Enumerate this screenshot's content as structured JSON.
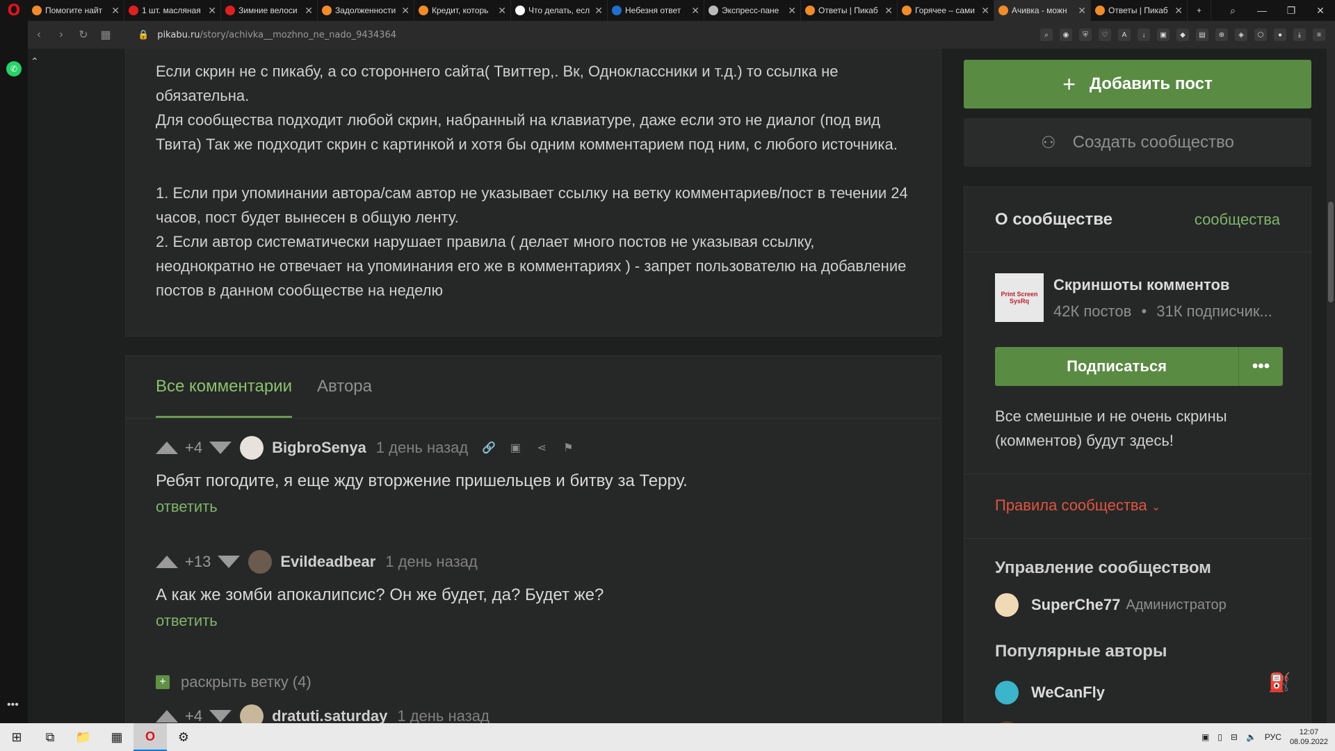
{
  "browser": {
    "tabs": [
      {
        "title": "Помогите найт",
        "fav_color": "#f28c2a"
      },
      {
        "title": "1 шт. масляная",
        "fav_color": "#e02020"
      },
      {
        "title": "Зимние велоси",
        "fav_color": "#e02020"
      },
      {
        "title": "Задолженности",
        "fav_color": "#f28c2a"
      },
      {
        "title": "Кредит, которь",
        "fav_color": "#f28c2a"
      },
      {
        "title": "Что делать, есл",
        "fav_color": "#ffffff"
      },
      {
        "title": "Небезня ответ",
        "fav_color": "#1f6fd1"
      },
      {
        "title": "Экспресс-пане",
        "fav_color": "#bbbbbb"
      },
      {
        "title": "Ответы | Пикаб",
        "fav_color": "#f28c2a"
      },
      {
        "title": "Горячее – сами",
        "fav_color": "#f28c2a"
      },
      {
        "title": "Ачивка - можн",
        "fav_color": "#f28c2a",
        "active": true
      },
      {
        "title": "Ответы | Пикаб",
        "fav_color": "#f28c2a"
      }
    ],
    "url_host": "pikabu.ru",
    "url_path": "/story/achivka__mozhno_ne_nado_9434364"
  },
  "post": {
    "para1": "Если скрин не с пикабу, а со стороннего сайта( Твиттер,. Вк, Одноклассники и т.д.) то ссылка не обязательна.",
    "para2": "Для сообщества подходит любой скрин, набранный на клавиатуре, даже если это не диалог (под вид Твита) Так же подходит скрин с картинкой и хотя бы одним комментарием под ним, с любого источника.",
    "rule1": "1. Если при упоминании автора/сам автор не указывает ссылку на ветку комментариев/пост в течении 24 часов, пост будет вынесен в общую ленту.",
    "rule2": "2. Если автор систематически нарушает правила ( делает много постов не указывая ссылку, неоднократно не отвечает на упоминания его же в комментариях ) - запрет пользователю на добавление постов в данном сообществе на неделю"
  },
  "comments_tabs": {
    "all": "Все комментарии",
    "author": "Автора"
  },
  "comments": [
    {
      "score": "+4",
      "author": "BigbroSenya",
      "time": "1 день назад",
      "text": "Ребят погодите, я еще жду вторжение пришельцев и битву за Терру.",
      "reply": "ответить"
    },
    {
      "score": "+13",
      "author": "Evildeadbear",
      "time": "1 день назад",
      "text": "А как же зомби апокалипсис? Он же будет, да? Будет же?",
      "reply": "ответить"
    },
    {
      "score": "+4",
      "author": "dratuti.saturday",
      "time": "1 день назад"
    }
  ],
  "expand_branch": "раскрыть ветку (4)",
  "sidebar": {
    "add_post": "Добавить пост",
    "create_community": "Создать сообщество",
    "about_title": "О сообществе",
    "about_link": "сообщества",
    "community_name": "Скриншоты комментов",
    "community_posts": "42К постов",
    "community_subs": "31К подписчик...",
    "logo_text": "Print Screen SysRq",
    "subscribe": "Подписаться",
    "more": "•••",
    "description": "Все смешные и не очень скрины (комментов) будут здесь!",
    "rules": "Правила сообщества",
    "management_title": "Управление сообществом",
    "admin_name": "SuperChe77",
    "admin_role": "Администратор",
    "popular_title": "Популярные авторы",
    "popular_author_1": "WeCanFly"
  },
  "taskbar": {
    "lang": "РУС",
    "time": "12:07",
    "date": "08.09.2022"
  }
}
